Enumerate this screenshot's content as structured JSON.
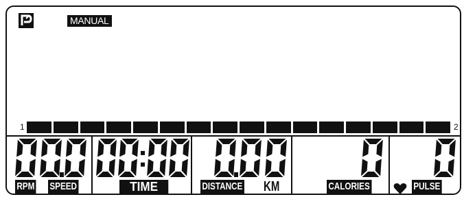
{
  "header": {
    "program_icon": "program-p-icon",
    "mode_label": "MANUAL"
  },
  "level_bar": {
    "start_label": "1",
    "end_label": "2",
    "segment_count": 16
  },
  "readouts": {
    "rpm_speed": {
      "value": "00.0",
      "labels": [
        "RPM",
        "SPEED"
      ]
    },
    "time": {
      "value": "00:00",
      "label": "TIME"
    },
    "distance": {
      "value": "0.00",
      "label": "DISTANCE",
      "unit": "KM"
    },
    "calories": {
      "value": "0",
      "label": "CALORIES"
    },
    "pulse": {
      "value": "0",
      "label": "PULSE",
      "icon": "heart-icon"
    }
  },
  "colors": {
    "ink": "#111111",
    "background": "#ffffff"
  }
}
